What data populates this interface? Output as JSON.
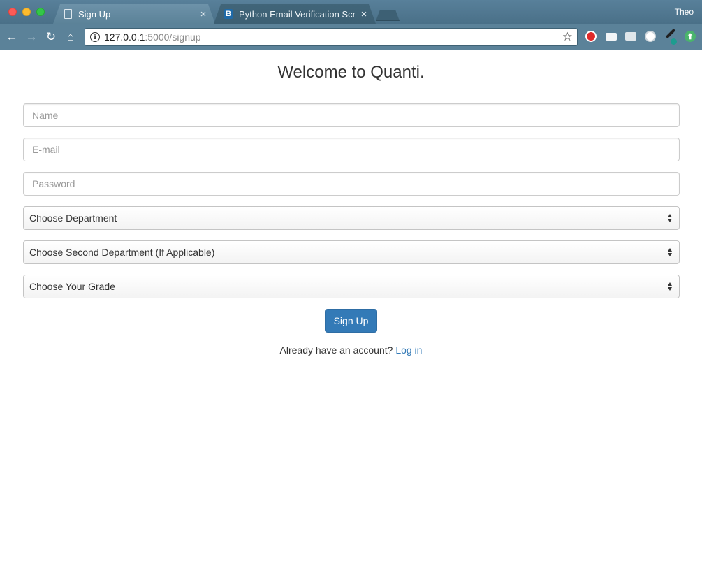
{
  "browser": {
    "profile_name": "Theo",
    "tabs": [
      {
        "title": "Sign Up",
        "favicon": "page-icon",
        "active": true
      },
      {
        "title": "Python Email Verification Scrip",
        "favicon": "B",
        "active": false
      }
    ],
    "close_glyph": "×",
    "url_host": "127.0.0.1",
    "url_rest": ":5000/signup",
    "info_glyph": "i",
    "nav_glyphs": {
      "back": "←",
      "forward": "→",
      "reload": "↻",
      "home": "⌂",
      "star": "☆",
      "upload": "⬆"
    }
  },
  "page": {
    "heading": "Welcome to Quanti.",
    "fields": {
      "name_placeholder": "Name",
      "email_placeholder": "E-mail",
      "password_placeholder": "Password"
    },
    "selects": {
      "department": "Choose Department",
      "second_department": "Choose Second Department (If Applicable)",
      "grade": "Choose Your Grade"
    },
    "submit_label": "Sign Up",
    "login_prompt": "Already have an account?",
    "login_link": "Log in"
  },
  "colors": {
    "primary": "#337ab7",
    "chrome": "#5b8299",
    "text": "#333333"
  }
}
